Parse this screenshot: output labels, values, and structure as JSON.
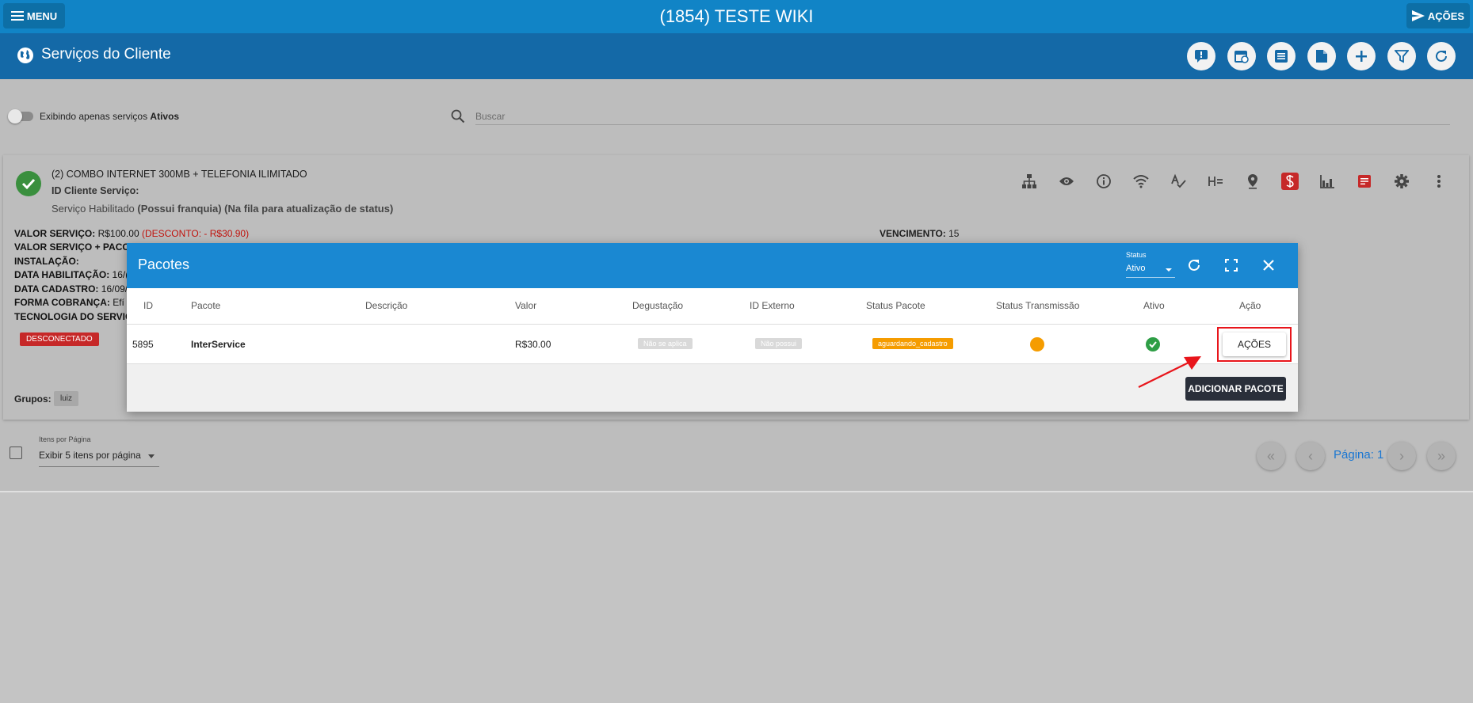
{
  "topbar": {
    "menu_label": "MENU",
    "title": "(1854) TESTE WIKI",
    "acoes_label": "AÇÕES"
  },
  "section": {
    "title": "Serviços do Cliente"
  },
  "filters": {
    "toggle_label_prefix": "Exibindo apenas serviços ",
    "toggle_label_bold": "Ativos",
    "search_placeholder": "Buscar"
  },
  "service": {
    "name": "(2) COMBO INTERNET 300MB + TELEFONIA ILIMITADO",
    "id_label": "ID Cliente Serviço:",
    "id_value": "",
    "status_prefix": "Serviço Habilitado ",
    "status_bold": "(Possui franquia) (Na fila para atualização de status)",
    "lines": [
      {
        "label": "VALOR SERVIÇO:",
        "value": " R$100.00 ",
        "extra": "(DESCONTO: - R$30.90)"
      },
      {
        "label": "VALOR SERVIÇO + PACOT",
        "value": "",
        "extra": ""
      },
      {
        "label": "INSTALAÇÃO:",
        "value": "",
        "extra": ""
      },
      {
        "label": "DATA HABILITAÇÃO:",
        "value": " 16/(",
        "extra": ""
      },
      {
        "label": "DATA CADASTRO:",
        "value": " 16/09/",
        "extra": ""
      },
      {
        "label": "FORMA COBRANÇA:",
        "value": " Efí -",
        "extra": ""
      },
      {
        "label": "TECNOLOGIA DO SERVIÇ",
        "value": "",
        "extra": ""
      }
    ],
    "vencimento_label": "VENCIMENTO:",
    "vencimento_value": " 15",
    "badge": "DESCONECTADO",
    "grupos_label": "Grupos:",
    "grupo_chip": "luiz"
  },
  "footer": {
    "items_per_page_label": "Itens por Página",
    "items_per_page_value": "Exibir 5 itens por página",
    "page_label": "Página: 1"
  },
  "modal": {
    "title": "Pacotes",
    "status_label": "Status",
    "status_value": "Ativo",
    "columns": [
      "ID",
      "Pacote",
      "Descrição",
      "Valor",
      "Degustação",
      "ID Externo",
      "Status Pacote",
      "Status Transmissão",
      "Ativo",
      "Ação"
    ],
    "row": {
      "id": "5895",
      "pacote": "InterService",
      "descricao": "",
      "valor": "R$30.00",
      "degustacao": "Não se aplica",
      "id_externo": "Não possui",
      "status_pacote": "aguardando_cadastro",
      "acao_label": "AÇÕES"
    },
    "add_button": "ADICIONAR PACOTE"
  },
  "colors": {
    "topbar": "#1184c6",
    "section": "#1469a7",
    "modal_head": "#1a88d2",
    "status_pill": "#f59c00",
    "badge_red": "#c62828",
    "highlight": "#e8151b"
  }
}
